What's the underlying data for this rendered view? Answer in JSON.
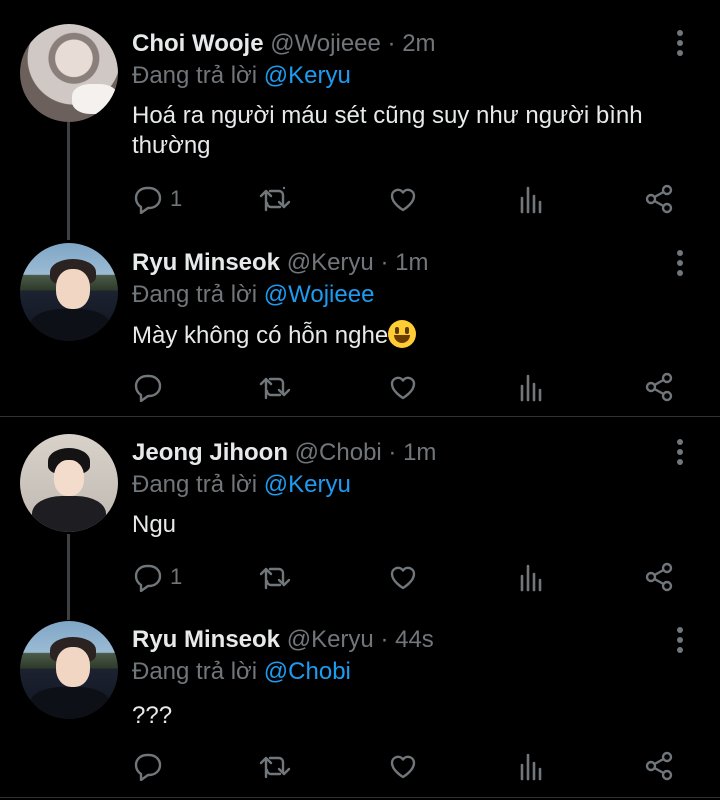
{
  "tweets": [
    {
      "name": "Choi Wooje",
      "handle": "@Wojieee",
      "time": "· 2m",
      "reply_prefix": "Đang trả lời",
      "reply_to": "@Keryu",
      "text": "Hoá ra người máu sét cũng suy như người bình thường",
      "reply_count": "1"
    },
    {
      "name": "Ryu Minseok",
      "handle": "@Keryu",
      "time": "· 1m",
      "reply_prefix": "Đang trả lời",
      "reply_to": "@Wojieee",
      "text": "Mày không có hỗn nghe",
      "reply_count": ""
    },
    {
      "name": "Jeong Jihoon",
      "handle": "@Chobi",
      "time": "· 1m",
      "reply_prefix": "Đang trả lời",
      "reply_to": "@Keryu",
      "text": "Ngu",
      "reply_count": "1"
    },
    {
      "name": "Ryu Minseok",
      "handle": "@Keryu",
      "time": "· 44s",
      "reply_prefix": "Đang trả lời",
      "reply_to": "@Chobi",
      "text": "???",
      "reply_count": ""
    }
  ],
  "icons": {
    "reply": "reply-icon",
    "retweet": "retweet-icon",
    "like": "heart-icon",
    "views": "analytics-icon",
    "share": "share-icon",
    "more": "more-options-icon",
    "emoji": "grinning-face-emoji"
  },
  "colors": {
    "background": "#000000",
    "text": "#e7e9ea",
    "secondary": "#71767b",
    "mention": "#1d9bf0",
    "divider": "#2f3336"
  }
}
